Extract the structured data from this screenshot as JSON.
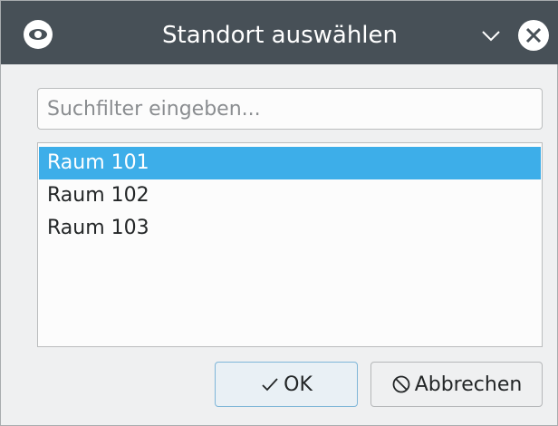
{
  "window": {
    "title": "Standort auswählen"
  },
  "icons": {
    "app": "eye-icon",
    "minimize": "chevron-down-icon",
    "close": "close-icon",
    "ok": "check-icon",
    "cancel": "cancel-icon"
  },
  "search": {
    "placeholder": "Suchfilter eingeben...",
    "value": ""
  },
  "list": {
    "items": [
      {
        "label": "Raum 101",
        "selected": true
      },
      {
        "label": "Raum 102",
        "selected": false
      },
      {
        "label": "Raum 103",
        "selected": false
      }
    ]
  },
  "buttons": {
    "ok_label": "OK",
    "cancel_label": "Abbrechen"
  },
  "colors": {
    "titlebar": "#475057",
    "selection": "#3daee9",
    "background": "#eff0f1"
  }
}
